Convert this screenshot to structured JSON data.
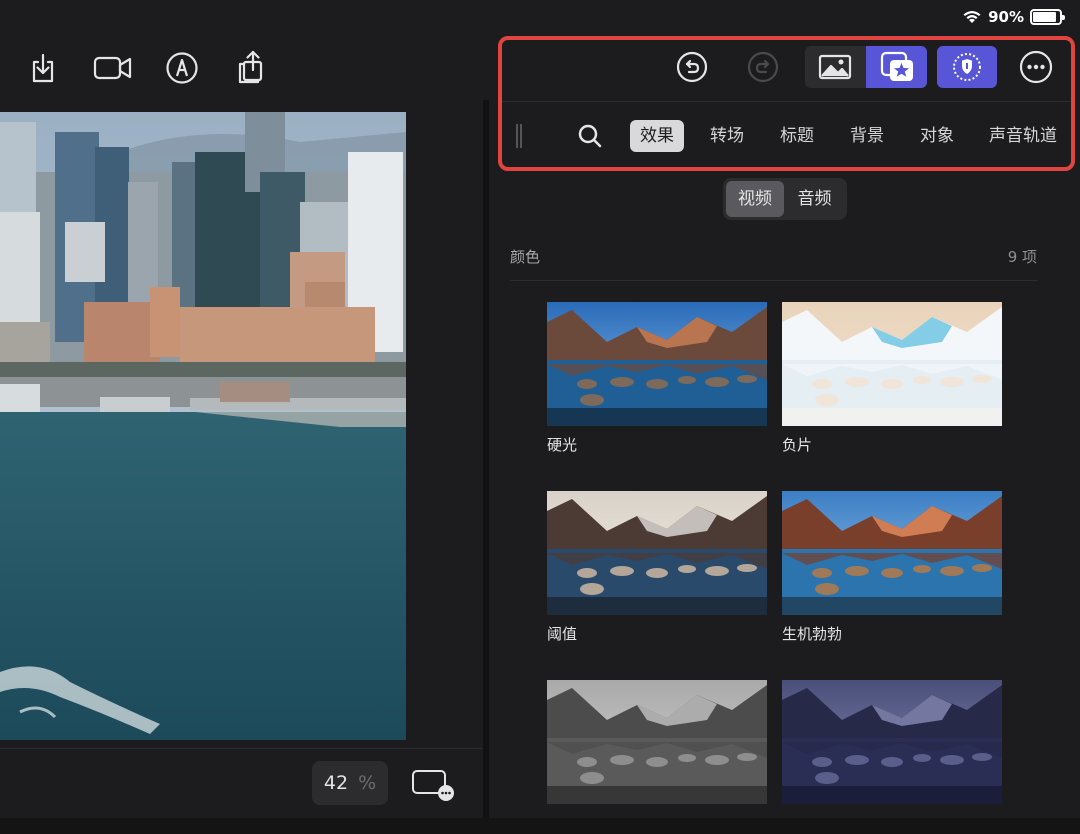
{
  "status_bar": {
    "battery_percent": "90%",
    "battery_level": 0.9
  },
  "left_toolbar": {
    "icons": [
      "download-icon",
      "camera-icon",
      "pen-icon",
      "share-icon"
    ]
  },
  "viewer": {
    "zoom_value": "42",
    "zoom_unit": "%"
  },
  "right_toolbar": {
    "icons": [
      "undo-icon",
      "redo-icon",
      "photo-icon",
      "favorites-icon",
      "shield-icon",
      "more-icon"
    ]
  },
  "browser_tabs": [
    {
      "label": "效果",
      "active": true
    },
    {
      "label": "转场",
      "active": false
    },
    {
      "label": "标题",
      "active": false
    },
    {
      "label": "背景",
      "active": false
    },
    {
      "label": "对象",
      "active": false
    },
    {
      "label": "声音轨道",
      "active": false
    }
  ],
  "media_segment": [
    {
      "label": "视频",
      "active": true
    },
    {
      "label": "音频",
      "active": false
    }
  ],
  "section": {
    "title": "颜色",
    "count": "9 项"
  },
  "effects": [
    {
      "name": "硬光",
      "style": "hard"
    },
    {
      "name": "负片",
      "style": "negative"
    },
    {
      "name": "阈值",
      "style": "threshold"
    },
    {
      "name": "生机勃勃",
      "style": "vibrant"
    },
    {
      "name": "",
      "style": "mono"
    },
    {
      "name": "",
      "style": "blue"
    }
  ],
  "colors": {
    "accent_purple": "#5856d6",
    "highlight_red": "#e0443e",
    "background": "#1c1c1e"
  }
}
